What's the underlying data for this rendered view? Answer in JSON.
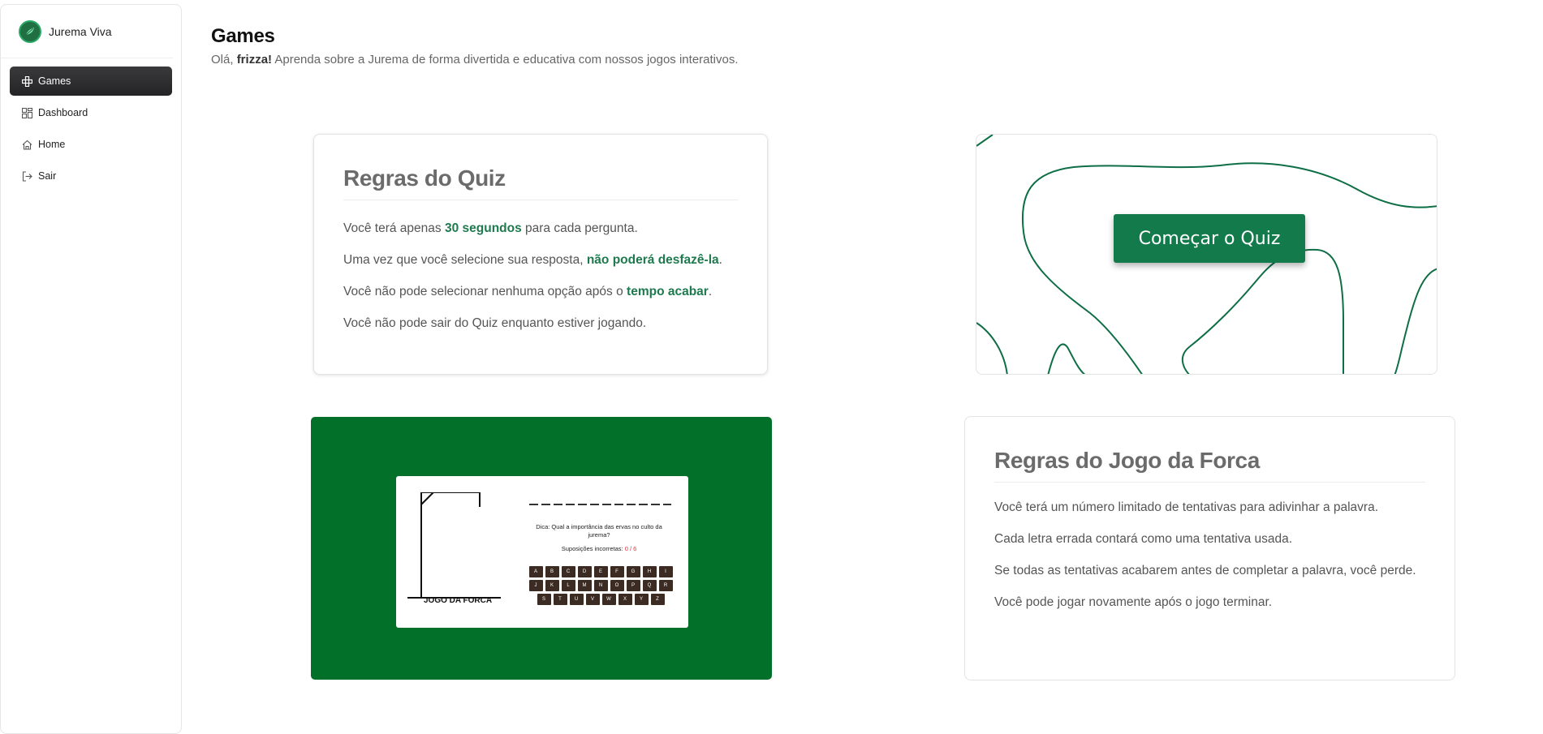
{
  "brand": {
    "name": "Jurema Viva"
  },
  "sidebar": {
    "items": [
      {
        "label": "Games",
        "icon": "gamepad-icon",
        "active": true
      },
      {
        "label": "Dashboard",
        "icon": "grid-icon",
        "active": false
      },
      {
        "label": "Home",
        "icon": "home-icon",
        "active": false
      },
      {
        "label": "Sair",
        "icon": "logout-icon",
        "active": false
      }
    ]
  },
  "header": {
    "title": "Games",
    "greeting_prefix": "Olá,",
    "username": "frizza!",
    "greeting_suffix": "Aprenda sobre a Jurema de forma divertida e educativa com nossos jogos interativos."
  },
  "quiz_rules": {
    "title": "Regras do Quiz",
    "lines": [
      {
        "pre": "Você terá apenas",
        "bold": "30 segundos",
        "post": "para cada pergunta."
      },
      {
        "pre": "Uma vez que você selecione sua resposta,",
        "bold": "não poderá desfazê-la",
        "post": "."
      },
      {
        "pre": "Você não pode selecionar nenhuma opção após o",
        "bold": "tempo acabar",
        "post": "."
      },
      {
        "pre": "Você não pode sair do Quiz enquanto estiver jogando.",
        "bold": "",
        "post": ""
      }
    ]
  },
  "quiz_start": {
    "button_label": "Começar o Quiz"
  },
  "hangman_preview": {
    "title": "JOGO DA FORCA",
    "hint": "Dica: Qual a importância das ervas no culto da jurema?",
    "guesses_label": "Suposições incorretas:",
    "guesses_value": "0 / 6",
    "keys": [
      [
        "A",
        "B",
        "C",
        "D",
        "E",
        "F",
        "G",
        "H",
        "I"
      ],
      [
        "J",
        "K",
        "L",
        "M",
        "N",
        "O",
        "P",
        "Q",
        "R"
      ],
      [
        "S",
        "T",
        "U",
        "V",
        "W",
        "X",
        "Y",
        "Z"
      ]
    ]
  },
  "forca_rules": {
    "title": "Regras do Jogo da Forca",
    "lines": [
      "Você terá um número limitado de tentativas para adivinhar a palavra.",
      "Cada letra errada contará como uma tentativa usada.",
      "Se todas as tentativas acabarem antes de completar a palavra, você perde.",
      "Você pode jogar novamente após o jogo terminar."
    ]
  },
  "colors": {
    "accent": "#127a4b",
    "tile_green": "#037029",
    "active_nav": "#2d2d2f",
    "highlight": "#1e7a4e"
  }
}
